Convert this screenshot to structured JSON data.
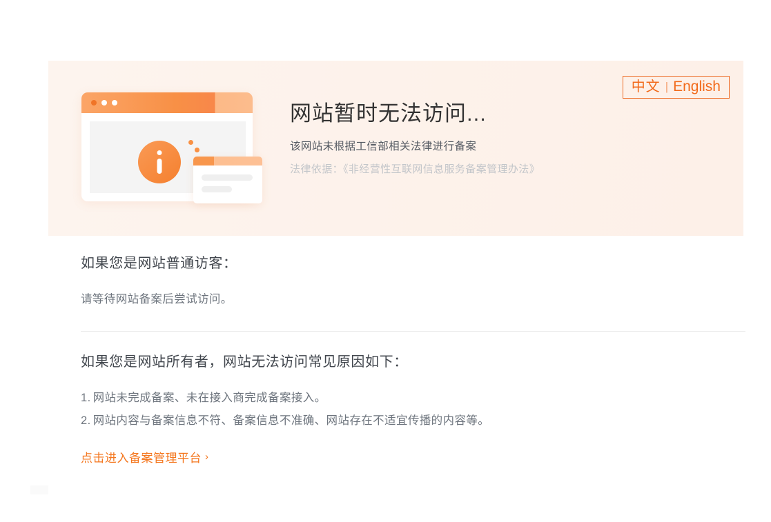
{
  "banner": {
    "language_switcher": {
      "chinese_label": "中文",
      "separator": "|",
      "english_label": "English"
    },
    "title": "网站暂时无法访问...",
    "subtitle": "该网站未根据工信部相关法律进行备案",
    "legal_basis": "法律依据：《非经营性互联网信息服务备案管理办法》"
  },
  "visitor_section": {
    "heading": "如果您是网站普通访客：",
    "body": "请等待网站备案后尝试访问。"
  },
  "owner_section": {
    "heading": "如果您是网站所有者，网站无法访问常见原因如下：",
    "reasons": [
      {
        "number": "1.",
        "text": "网站未完成备案、未在接入商完成备案接入。"
      },
      {
        "number": "2.",
        "text": "网站内容与备案信息不符、备案信息不准确、网站存在不适宜传播的内容等。"
      }
    ]
  },
  "cta": {
    "label": "点击进入备案管理平台",
    "chevron": "›"
  },
  "colors": {
    "accent": "#f4761d",
    "banner_background": "#fdf3ec",
    "heading_text": "#41464d",
    "body_text": "#6e757e",
    "muted_text": "#c3c6ca"
  }
}
